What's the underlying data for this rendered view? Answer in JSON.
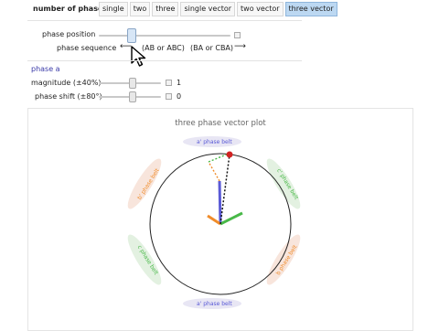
{
  "header": {
    "phases_label": "number of phases",
    "tabs": [
      "single",
      "two",
      "three",
      "single vector",
      "two vector",
      "three vector"
    ],
    "active_tab": "three vector"
  },
  "controls": {
    "phase_position_label": "phase position",
    "phase_sequence_label": "phase sequence",
    "seq_left_arrow": "⟵",
    "seq_option_1": "(AB or ABC)",
    "seq_option_2": "(BA or CBA)",
    "seq_right_arrow": "⟶"
  },
  "phase_a": {
    "title": "phase a",
    "magnitude_label": "magnitude (±40%)",
    "magnitude_value": "1",
    "shift_label": "phase shift (±80°)",
    "shift_value": "0"
  },
  "plot": {
    "title": "three phase vector plot",
    "belts": {
      "a_top": "a' phase belt",
      "c_right_top": "c' phase belt",
      "b_right_bottom": "b phase belt",
      "a_bottom": "a' phase belt",
      "c_left_bottom": "c phase belt",
      "b_left_top": "b' phase belt"
    }
  },
  "colors": {
    "accent": "#bcd8f2",
    "phase_a": "#5a5ad6",
    "phase_b": "#f08c2a",
    "phase_c": "#48b848",
    "resultant": "#d22222"
  }
}
